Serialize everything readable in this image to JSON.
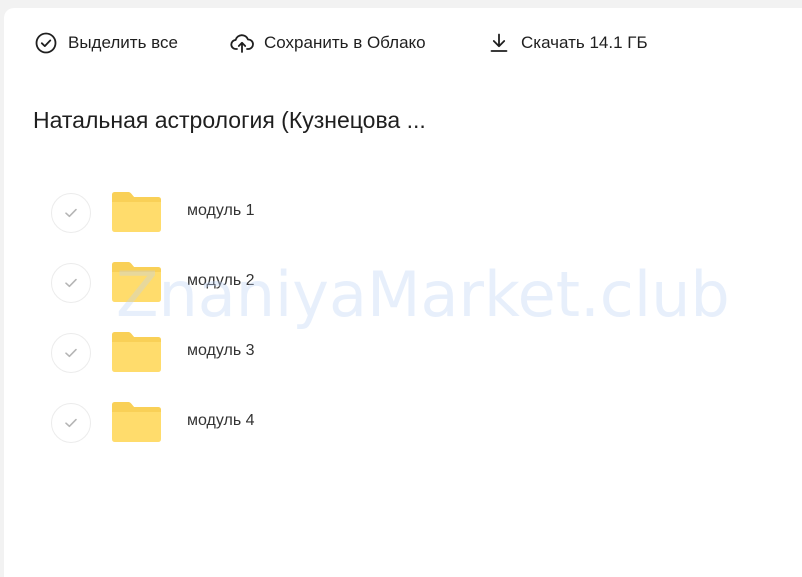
{
  "toolbar": {
    "select_all_label": "Выделить все",
    "save_to_cloud_label": "Сохранить в Облако",
    "download_label": "Скачать 14.1 ГБ"
  },
  "folder": {
    "title": "Натальная астрология (Кузнецова ..."
  },
  "items": [
    {
      "name": "модуль 1",
      "icon": "folder-icon"
    },
    {
      "name": "модуль 2",
      "icon": "folder-icon"
    },
    {
      "name": "модуль 3",
      "icon": "folder-icon"
    },
    {
      "name": "модуль 4",
      "icon": "folder-icon"
    }
  ],
  "watermark": "ZnaniyaMarket.club",
  "colors": {
    "folder_yellow": "#ffdc6c",
    "folder_tab": "#f9d057",
    "check_gray": "#b5b5b5",
    "watermark_blue": "#bcd2f5"
  }
}
